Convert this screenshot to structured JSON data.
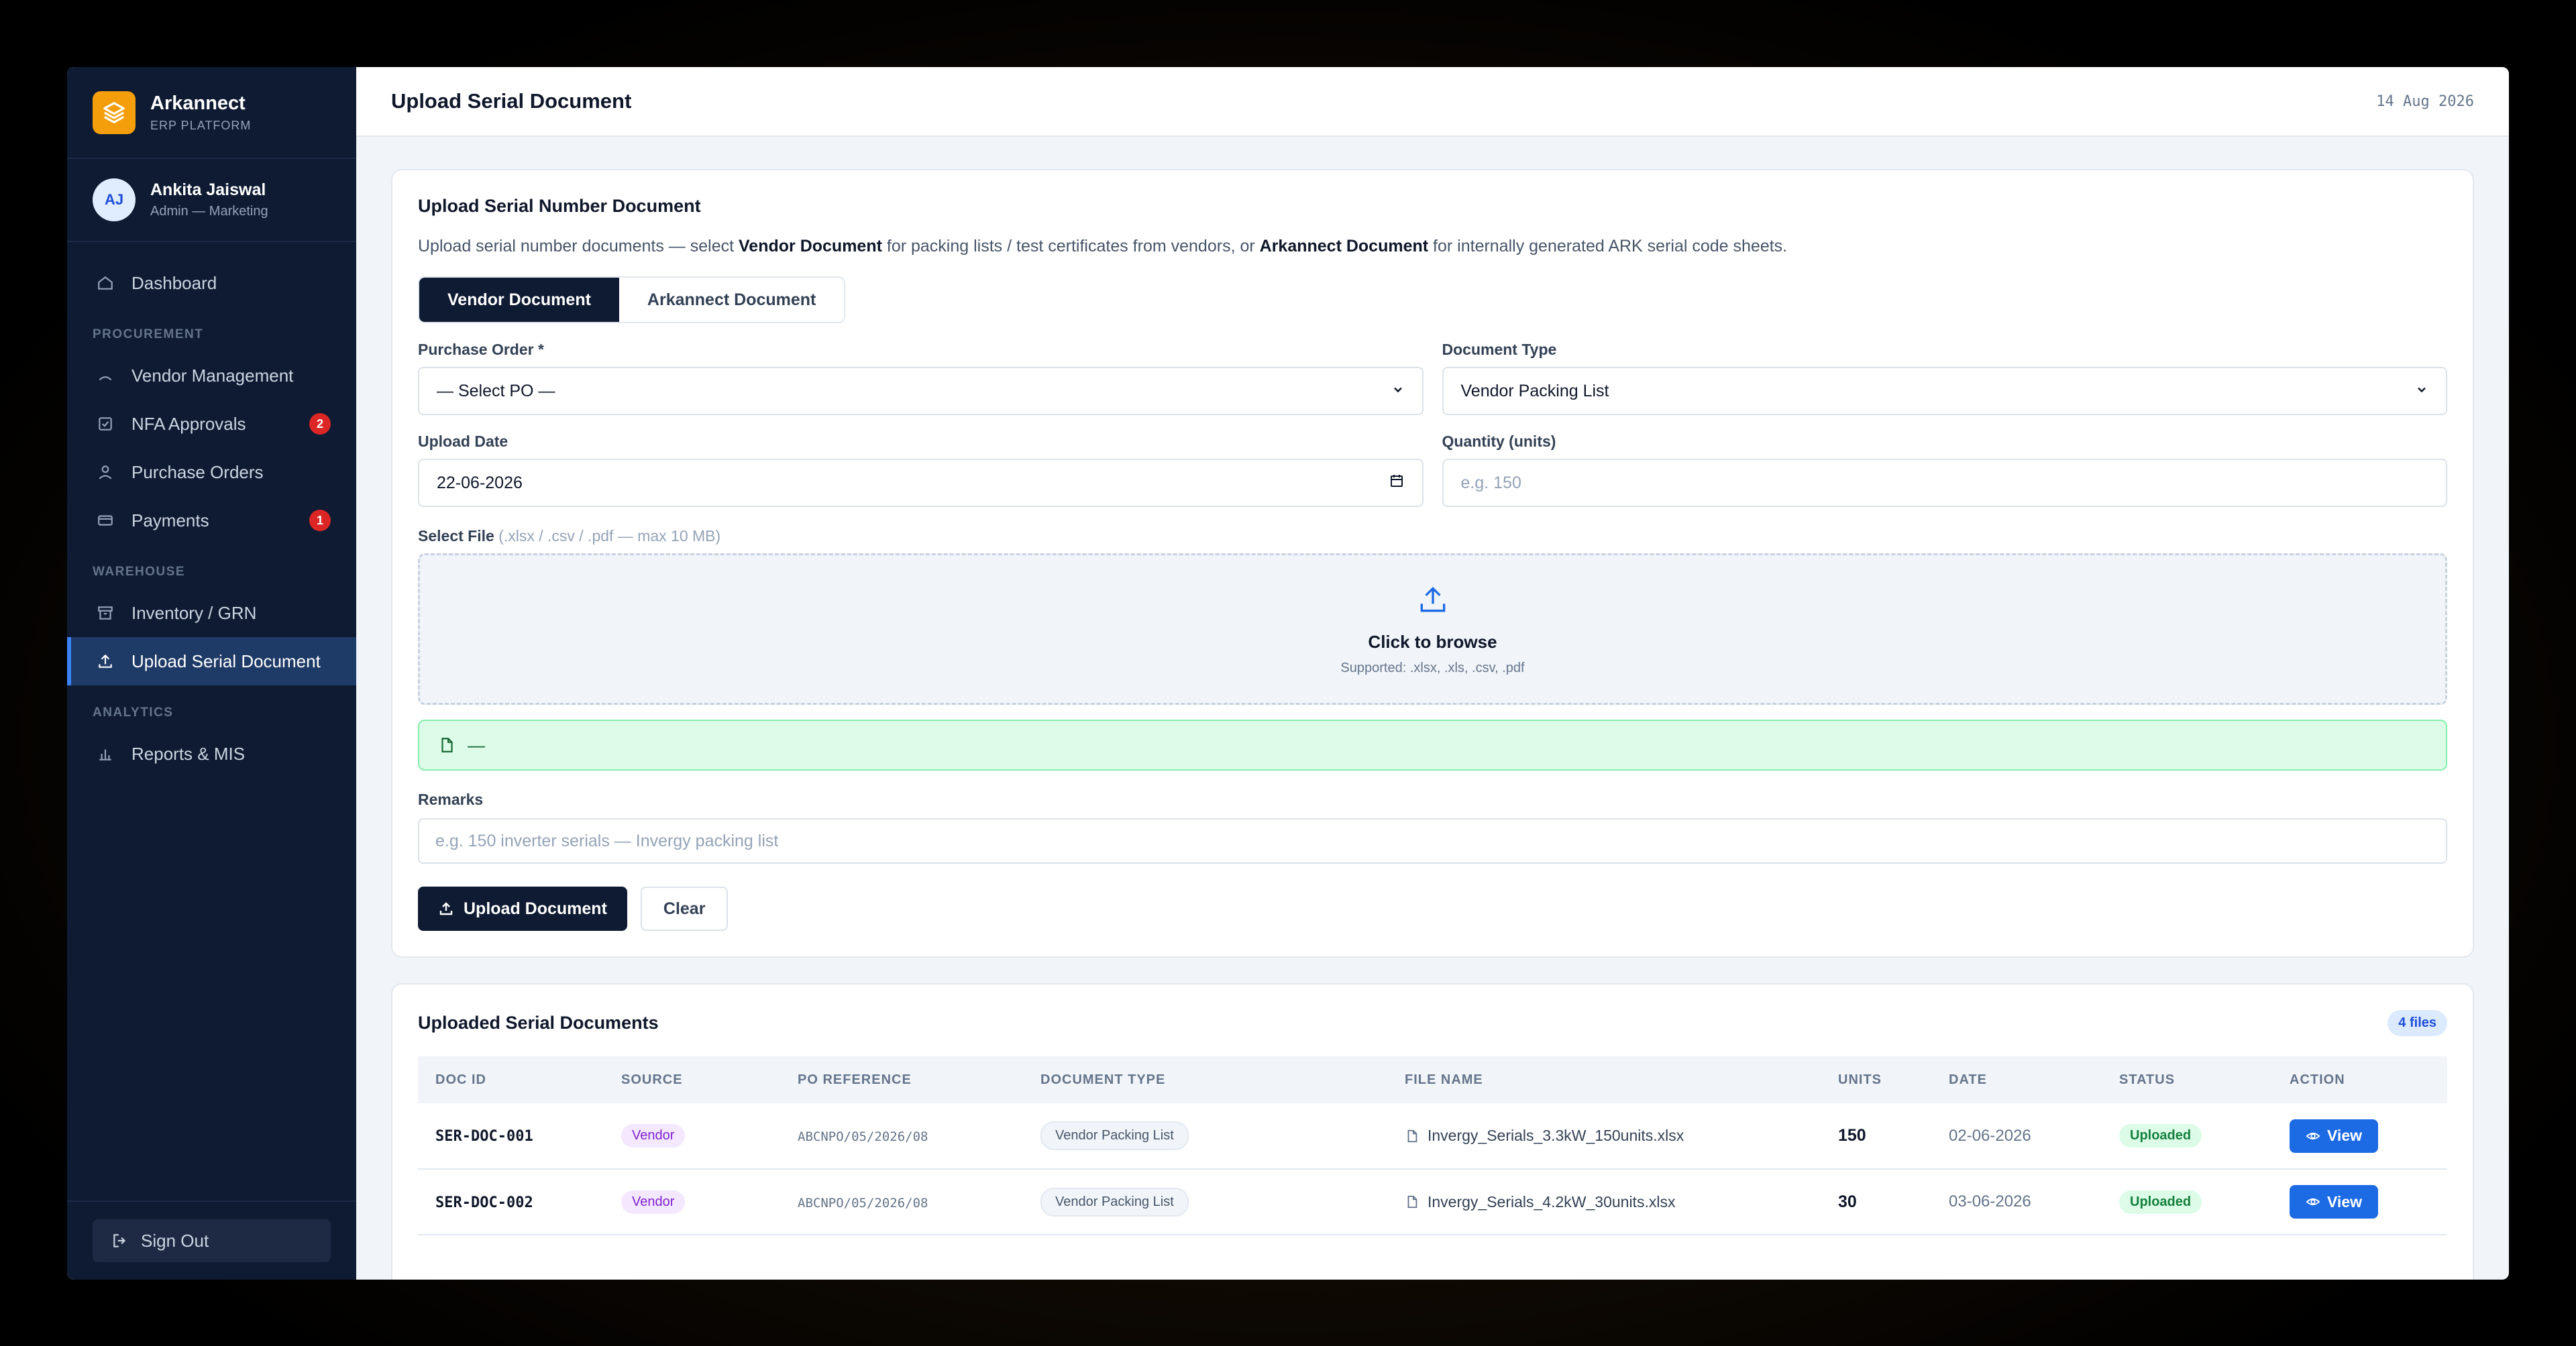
{
  "brand": {
    "name": "Arkannect",
    "subtitle": "ERP PLATFORM"
  },
  "user": {
    "initials": "AJ",
    "name": "Ankita Jaiswal",
    "role": "Admin — Marketing"
  },
  "nav": {
    "dashboard": "Dashboard",
    "section_procurement": "PROCUREMENT",
    "vendor_management": "Vendor Management",
    "nfa_approvals": "NFA Approvals",
    "nfa_badge": "2",
    "purchase_orders": "Purchase Orders",
    "payments": "Payments",
    "payments_badge": "1",
    "section_warehouse": "WAREHOUSE",
    "inventory": "Inventory / GRN",
    "upload_serial": "Upload Serial Document",
    "section_analytics": "ANALYTICS",
    "reports": "Reports & MIS",
    "sign_out": "Sign Out"
  },
  "header": {
    "title": "Upload Serial Document",
    "date": "14 Aug 2026"
  },
  "form": {
    "title": "Upload Serial Number Document",
    "desc_1": "Upload serial number documents — select ",
    "desc_vendor": "Vendor Document",
    "desc_2": " for packing lists / test certificates from vendors, or ",
    "desc_ark": "Arkannect Document",
    "desc_3": " for internally generated ARK serial code sheets.",
    "tab_vendor": "Vendor Document",
    "tab_arkannect": "Arkannect Document",
    "po_label": "Purchase Order *",
    "po_value": "— Select PO —",
    "doctype_label": "Document Type",
    "doctype_value": "Vendor Packing List",
    "upload_date_label": "Upload Date",
    "upload_date_value": "22-06-2026",
    "quantity_label": "Quantity (units)",
    "quantity_placeholder": "e.g. 150",
    "file_label": "Select File",
    "file_hint": " (.xlsx / .csv / .pdf — max 10 MB)",
    "dropzone_title": "Click to browse",
    "dropzone_sub": "Supported: .xlsx, .xls, .csv, .pdf",
    "selected_file": "—",
    "remarks_label": "Remarks",
    "remarks_placeholder": "e.g. 150 inverter serials — Invergy packing list",
    "upload_button": "Upload Document",
    "clear_button": "Clear"
  },
  "uploaded": {
    "title": "Uploaded Serial Documents",
    "count": "4 files",
    "columns": [
      "DOC ID",
      "SOURCE",
      "PO REFERENCE",
      "DOCUMENT TYPE",
      "FILE NAME",
      "UNITS",
      "DATE",
      "STATUS",
      "ACTION"
    ],
    "rows": [
      {
        "doc_id": "SER-DOC-001",
        "source": "Vendor",
        "po_ref": "ABCNPO/05/2026/08",
        "doc_type": "Vendor Packing List",
        "file_name": "Invergy_Serials_3.3kW_150units.xlsx",
        "units": "150",
        "date": "02-06-2026",
        "status": "Uploaded",
        "action": "View"
      },
      {
        "doc_id": "SER-DOC-002",
        "source": "Vendor",
        "po_ref": "ABCNPO/05/2026/08",
        "doc_type": "Vendor Packing List",
        "file_name": "Invergy_Serials_4.2kW_30units.xlsx",
        "units": "30",
        "date": "03-06-2026",
        "status": "Uploaded",
        "action": "View"
      }
    ]
  },
  "colors": {
    "sidebar": "#0f1b33",
    "accent": "#f59e0b",
    "primary": "#1d6ae5",
    "success": "#15803d",
    "danger": "#dc2626"
  }
}
